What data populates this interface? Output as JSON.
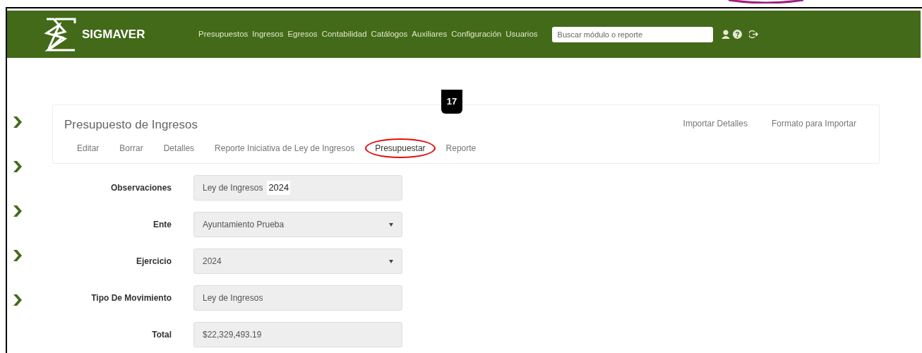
{
  "navbar": {
    "brand": "SIGMAVER",
    "menu": [
      "Presupuestos",
      "Ingresos",
      "Egresos",
      "Contabilidad",
      "Catálogos",
      "Auxiliares",
      "Configuración",
      "Usuarios"
    ],
    "search": {
      "placeholder": "Buscar módulo o reporte"
    }
  },
  "sidebar": {
    "chevron_count_rows": [
      {
        "kind": "chevron"
      },
      {
        "kind": "chevron"
      },
      {
        "kind": "chevron"
      },
      {
        "kind": "chevron"
      },
      {
        "kind": "chevron"
      }
    ]
  },
  "panel": {
    "title": "Presupuesto de Ingresos",
    "actions": [
      {
        "label": "Editar",
        "highlighted": false
      },
      {
        "label": "Borrar",
        "highlighted": false
      },
      {
        "label": "Detalles",
        "highlighted": false
      },
      {
        "label": "Reporte Iniciativa de Ley de Ingresos",
        "highlighted": false
      },
      {
        "label": "Presupuestar",
        "highlighted": true
      },
      {
        "label": "Reporte",
        "highlighted": false
      }
    ],
    "right_actions": [
      "Importar Detalles",
      "Formato para Importar"
    ],
    "callout": "17"
  },
  "form": [
    {
      "label": "Observaciones",
      "kind": "text",
      "value": "Ley de Ingresos",
      "extra": "2024"
    },
    {
      "label": "Ente",
      "kind": "select",
      "value": "Ayuntamiento Prueba"
    },
    {
      "label": "Ejercicio",
      "kind": "select",
      "value": "2024"
    },
    {
      "label": "Tipo De Movimiento",
      "kind": "text",
      "value": "Ley de Ingresos"
    },
    {
      "label": "Total",
      "kind": "text",
      "value": "$22,329,493.19"
    }
  ]
}
